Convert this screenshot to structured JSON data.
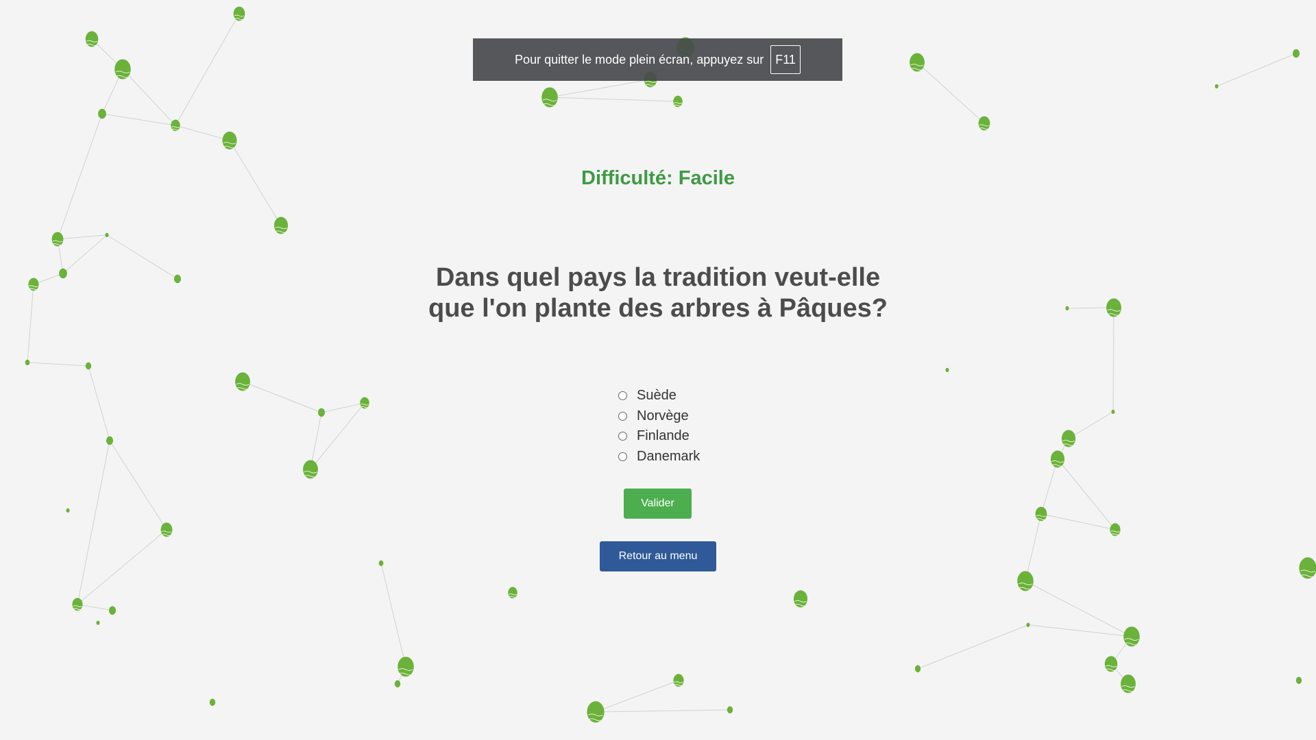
{
  "fullscreen_notice": {
    "text": "Pour quitter le mode plein écran, appuyez sur",
    "key": "F11"
  },
  "quiz": {
    "difficulty": "Difficulté: Facile",
    "question": "Dans quel pays la tradition veut-elle que l'on plante des arbres à Pâques?",
    "options": [
      "Suède",
      "Norvège",
      "Finlande",
      "Danemark"
    ],
    "selected": null,
    "submit_label": "Valider",
    "menu_label": "Retour au menu"
  },
  "colors": {
    "background": "#f4f4f4",
    "accent_green": "#3e9a44",
    "egg_green": "#6ab23a",
    "submit_button": "#4cae4f",
    "menu_button": "#2f5998"
  },
  "icons": {
    "egg": "easter-egg-icon",
    "link": "network-line"
  }
}
